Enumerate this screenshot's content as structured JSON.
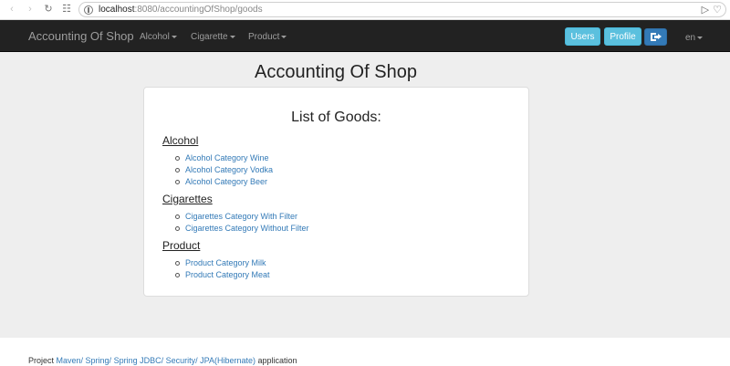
{
  "browser": {
    "url_host": "localhost",
    "url_path": ":8080/accountingOfShop/goods"
  },
  "navbar": {
    "brand": "Accounting Of Shop",
    "menus": [
      {
        "label": "Alcohol"
      },
      {
        "label": "Cigarette"
      },
      {
        "label": "Product"
      }
    ],
    "users_label": "Users",
    "profile_label": "Profile",
    "language": "en"
  },
  "page": {
    "title": "Accounting Of Shop",
    "panel_title": "List of Goods:"
  },
  "categories": [
    {
      "name": "Alcohol",
      "items": [
        "Alcohol Category Wine",
        "Alcohol Category Vodka",
        "Alcohol Category Beer"
      ]
    },
    {
      "name": "Cigarettes",
      "items": [
        "Cigarettes Category With Filter",
        "Cigarettes Category Without Filter"
      ]
    },
    {
      "name": "Product",
      "items": [
        "Product Category Milk",
        "Product Category Meat"
      ]
    }
  ],
  "footer": {
    "prefix": "Project ",
    "links": [
      "Maven/",
      " Spring/",
      " Spring JDBC/",
      " Security/",
      " JPA(Hibernate)"
    ],
    "suffix": " application"
  },
  "colors": {
    "navbar_bg": "#222222",
    "info_button": "#5bc0de",
    "primary_button": "#337ab7",
    "link": "#337ab7",
    "page_bg": "#eeeeee"
  }
}
